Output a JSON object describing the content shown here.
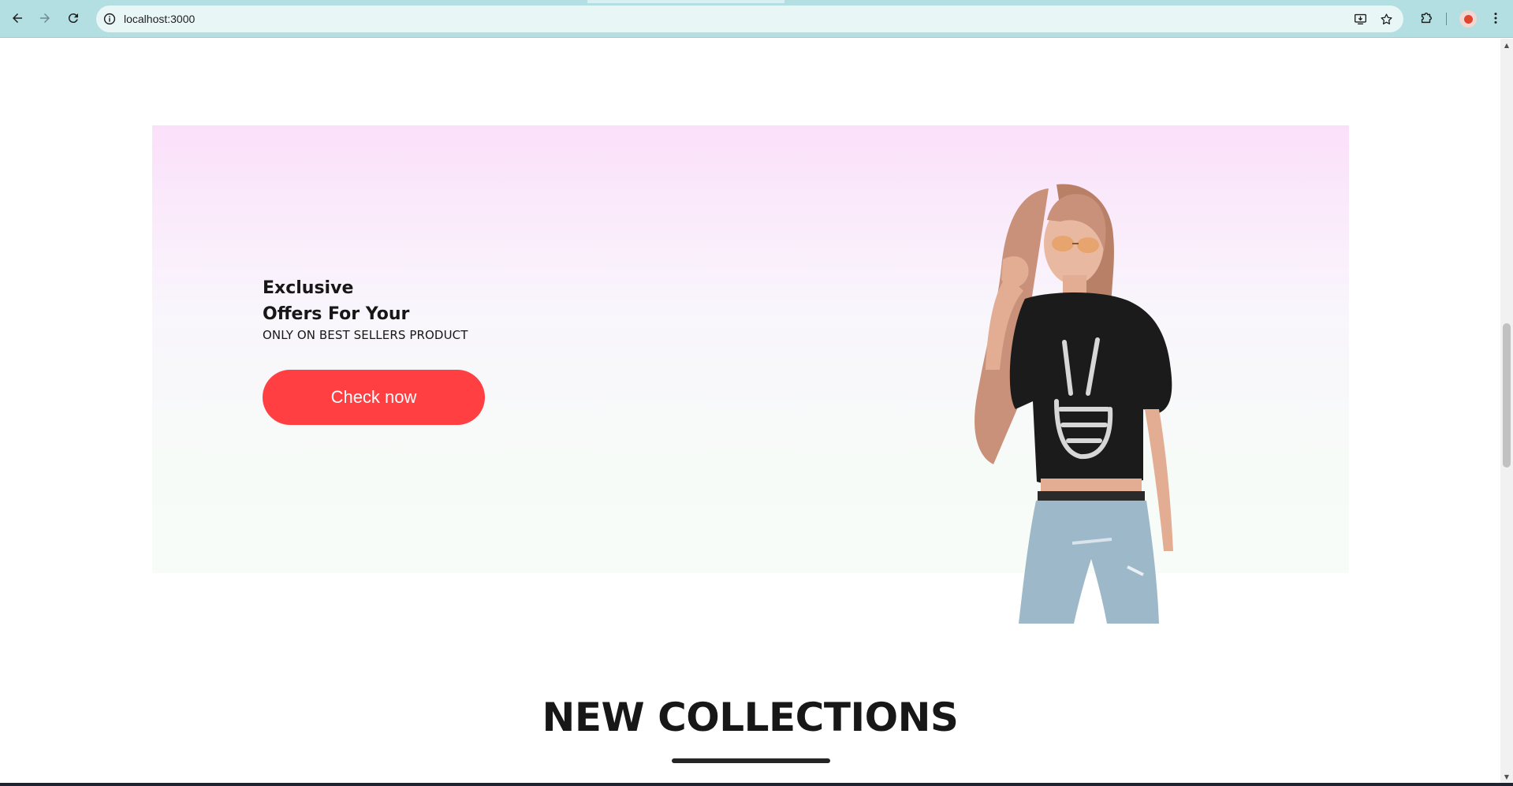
{
  "browser": {
    "url": "localhost:3000",
    "icons": {
      "back": "back-arrow-icon",
      "forward": "forward-arrow-icon",
      "reload": "reload-icon",
      "site_info": "info-icon",
      "install": "install-app-icon",
      "bookmark": "star-icon",
      "extensions": "puzzle-icon",
      "profile": "avatar",
      "menu": "kebab-menu-icon"
    },
    "colors": {
      "toolbar": "#b3dfe2",
      "omnibox": "#e9f6f6"
    }
  },
  "offers": {
    "title_line1": "Exclusive",
    "title_line2": "Offers For Your",
    "subtitle": "ONLY ON BEST SELLERS PRODUCT",
    "button_label": "Check now",
    "colors": {
      "gradient_top": "#fbe0fa",
      "gradient_bottom": "#f8fcf9",
      "button": "#ff3f42"
    }
  },
  "collections": {
    "title": "NEW COLLECTIONS"
  }
}
